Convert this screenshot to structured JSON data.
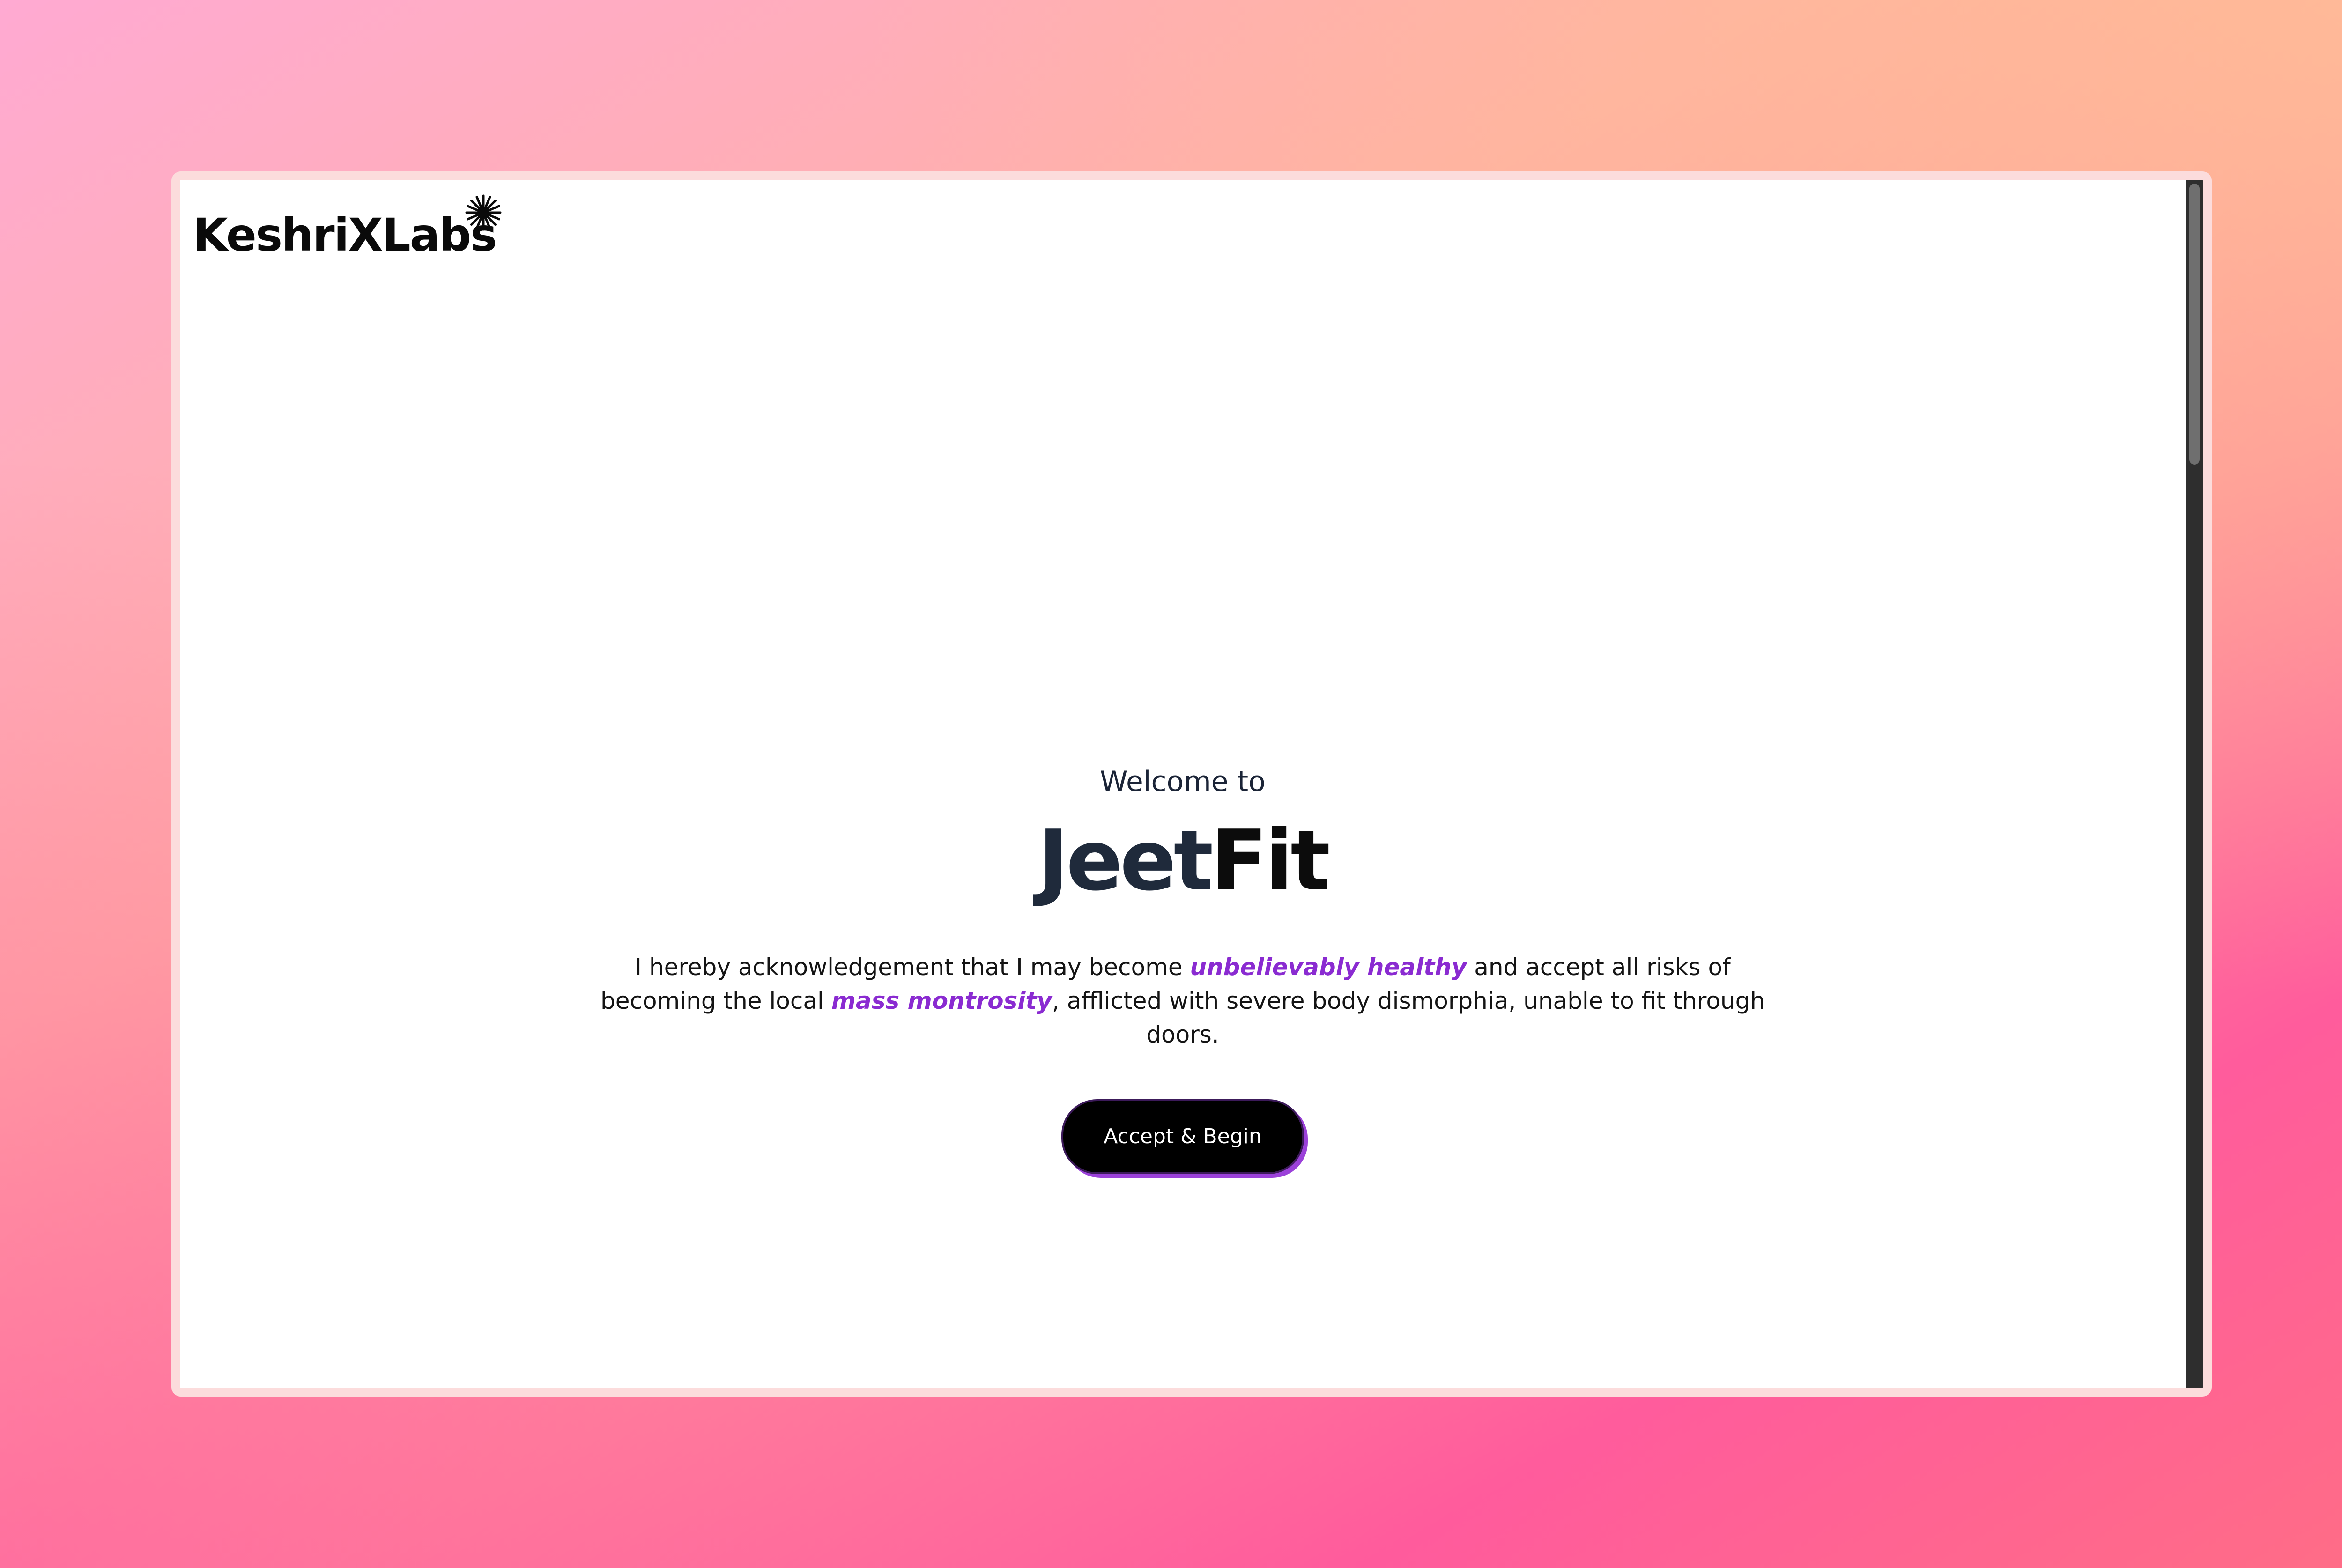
{
  "logo": {
    "text": "KeshriXLabs",
    "icon": "starburst-icon"
  },
  "hero": {
    "welcome": "Welcome to",
    "brand_part_a": "Jeet",
    "brand_part_b": "Fit",
    "disclaimer": {
      "text_1": "I hereby acknowledgement that I may become ",
      "highlight_1": "unbelievably healthy",
      "text_2": " and accept all risks of becoming the local ",
      "highlight_2": "mass montrosity",
      "text_3": ", afflicted with severe body dismorphia, unable to fit through doors."
    },
    "cta_label": "Accept & Begin"
  },
  "colors": {
    "accent": "#8a2bd1",
    "heading": "#1f2a3b",
    "button_bg": "#000000",
    "button_shadow": "#9b41d9"
  }
}
